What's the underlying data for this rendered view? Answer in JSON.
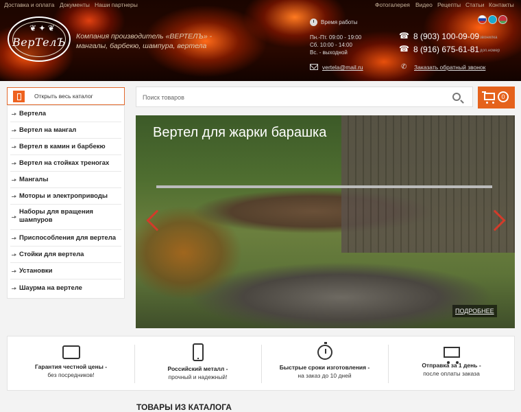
{
  "top_links": {
    "left": [
      "Доставка и оплата",
      "Документы",
      "Наши партнеры"
    ],
    "right": [
      "Фотогалерея",
      "Видео",
      "Рецепты",
      "Статьи",
      "Контакты"
    ]
  },
  "logo": {
    "text": "ВерТелЪ"
  },
  "tagline": "Компания производитель «ВЕРТЕЛЪ» - мангалы, барбекю, шампура, вертела",
  "hours": {
    "title": "Время работы",
    "lines": [
      "Пн.-Пт. 09:00 - 19:00",
      "Сб. 10:00 - 14:00",
      "Вс. - выходной"
    ]
  },
  "contacts": {
    "phone1": "8 (903) 100-09-09",
    "phone1_note": "звонилка",
    "phone2": "8 (916) 675-61-81",
    "phone2_note": "доп.номер",
    "email": "vertela@mail.ru",
    "callback": "Заказать обратный звонок"
  },
  "colors": {
    "accent": "#e5621c",
    "arrow": "#d33b2a"
  },
  "catalog_button": "Открыть весь каталог",
  "menu": [
    "Вертела",
    "Вертел на мангал",
    "Вертел в камин и барбекю",
    "Вертел на стойках треногах",
    "Мангалы",
    "Моторы и электроприводы",
    "Наборы для вращения шампуров",
    "Приспособления для вертела",
    "Стойки для вертела",
    "Установки",
    "Шаурма на вертеле"
  ],
  "search": {
    "placeholder": "Поиск товаров"
  },
  "cart": {
    "count": "0"
  },
  "banner": {
    "title": "Вертел для жарки барашка",
    "more": "ПОДРОБНЕЕ"
  },
  "features": [
    {
      "icon": "wallet-icon",
      "title": "Гарантия честной цены -",
      "sub": "без посредников!"
    },
    {
      "icon": "smartphone-icon",
      "title": "Российский металл -",
      "sub": "прочный и надежный!"
    },
    {
      "icon": "stopwatch-icon",
      "title": "Быстрые сроки изготовления -",
      "sub": "на заказ до 10 дней"
    },
    {
      "icon": "truck-icon",
      "title": "Отправка за 1 день -",
      "sub": "после оплаты заказа"
    }
  ],
  "section_title": "ТОВАРЫ ИЗ КАТАЛОГА"
}
